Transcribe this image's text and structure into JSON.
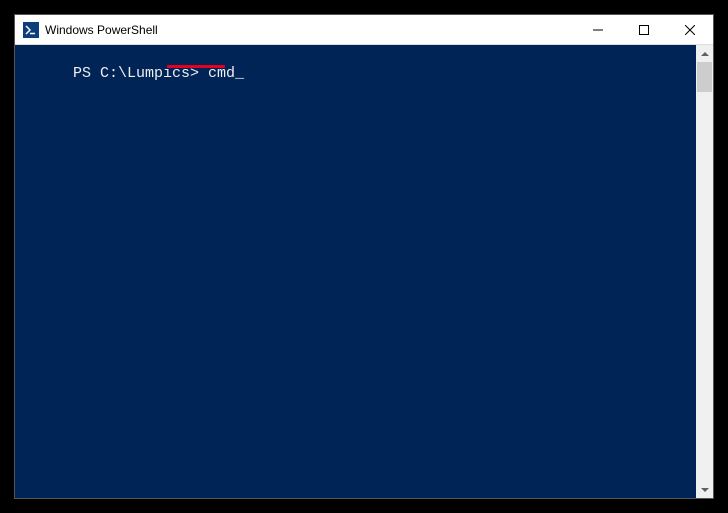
{
  "window": {
    "title": "Windows PowerShell"
  },
  "console": {
    "prompt": "PS C:\\Lumpics> ",
    "command": "cmd",
    "cursor": "_"
  },
  "annotation": {
    "underline_color": "#e6001f"
  },
  "colors": {
    "console_bg": "#012456",
    "console_fg": "#eeedf0"
  }
}
